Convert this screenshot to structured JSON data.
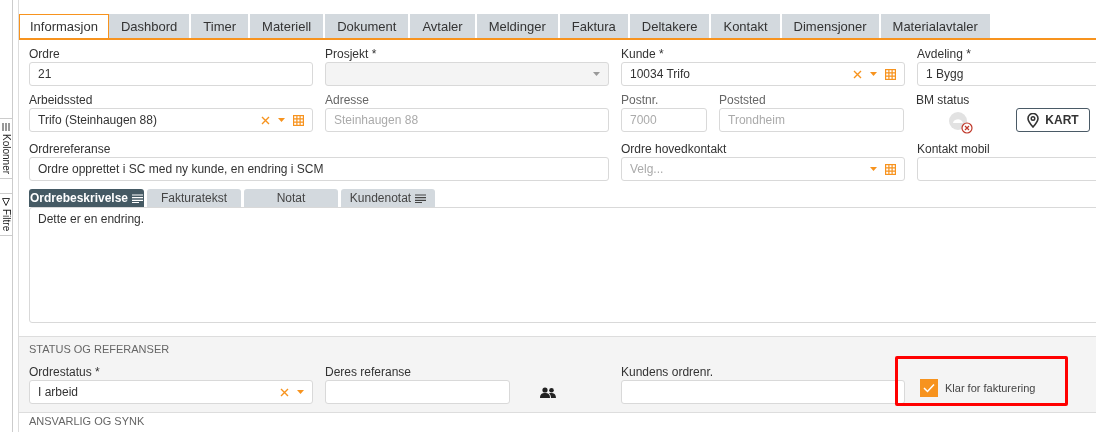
{
  "side_tabs": [
    {
      "label": "Kolonner",
      "kind": "columns"
    },
    {
      "label": "Filtre",
      "kind": "filter"
    }
  ],
  "tabs": [
    {
      "label": "Informasjon",
      "selected": true
    },
    {
      "label": "Dashbord",
      "selected": false
    },
    {
      "label": "Timer",
      "selected": false
    },
    {
      "label": "Materiell",
      "selected": false
    },
    {
      "label": "Dokument",
      "selected": false
    },
    {
      "label": "Avtaler",
      "selected": false
    },
    {
      "label": "Meldinger",
      "selected": false
    },
    {
      "label": "Faktura",
      "selected": false
    },
    {
      "label": "Deltakere",
      "selected": false
    },
    {
      "label": "Kontakt",
      "selected": false
    },
    {
      "label": "Dimensjoner",
      "selected": false
    },
    {
      "label": "Materialavtaler",
      "selected": false
    }
  ],
  "form_rows": [
    [
      {
        "label": "Ordre",
        "value": "21",
        "kind": "text"
      },
      {
        "label": "Prosjekt *",
        "kind": "select"
      },
      {
        "label": "Kunde *",
        "value": "10034 Trifo",
        "kind": "lookup"
      },
      {
        "label": "Avdeling *",
        "value": "1 Bygg",
        "kind": "text"
      }
    ],
    [
      {
        "label": "Arbeidssted",
        "value": "Trifo (Steinhaugen 88)",
        "kind": "lookup"
      },
      {
        "label": "Adresse",
        "value": "Steinhaugen 88",
        "kind": "readonly"
      },
      {
        "label": "Postnr.",
        "value": "7000",
        "kind": "readonly"
      },
      {
        "label": "Poststed",
        "value": "Trondheim",
        "kind": "readonly"
      },
      {
        "label": "BM status",
        "kind": "status"
      },
      {
        "label": "KART",
        "kind": "map-button"
      }
    ],
    [
      {
        "label": "Ordrereferanse",
        "value": "Ordre opprettet i SC med ny kunde, en endring i SCM",
        "kind": "text"
      },
      {
        "label": "Ordre hovedkontakt",
        "placeholder": "Velg...",
        "kind": "picker"
      },
      {
        "label": "Kontakt mobil",
        "kind": "text"
      }
    ]
  ],
  "editor": {
    "tabs": [
      {
        "label": "Ordrebeskrivelse",
        "selected": true,
        "has_text": true
      },
      {
        "label": "Fakturatekst",
        "selected": false,
        "has_text": false
      },
      {
        "label": "Notat",
        "selected": false,
        "has_text": false
      },
      {
        "label": "Kundenotat",
        "selected": false,
        "has_text": true
      }
    ],
    "text": "Dette er en endring."
  },
  "status_section": {
    "title": "STATUS OG REFERANSER",
    "fields": [
      {
        "label": "Ordrestatus *",
        "value": "I arbeid",
        "kind": "combo"
      },
      {
        "label": "Deres referanse",
        "kind": "text"
      },
      {
        "kind": "contacts"
      },
      {
        "label": "Kundens ordrenr.",
        "kind": "text"
      },
      {
        "label": "Klar for fakturering",
        "kind": "checkbox",
        "checked": true,
        "highlighted": true
      }
    ]
  },
  "next_section": {
    "title": "ANSVARLIG OG SYNK"
  }
}
